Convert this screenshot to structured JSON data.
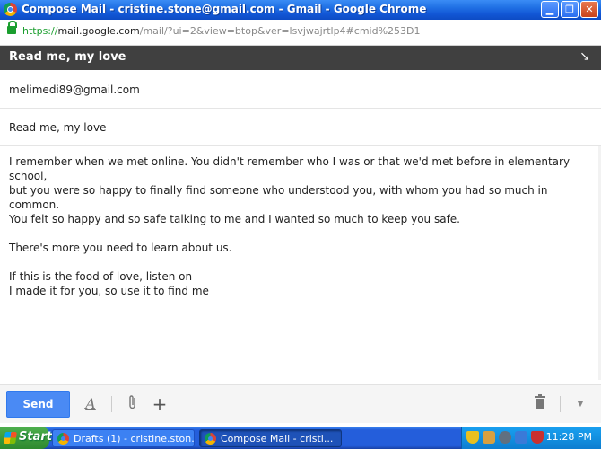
{
  "window": {
    "title": "Compose Mail - cristine.stone@gmail.com - Gmail - Google Chrome"
  },
  "address_bar": {
    "scheme": "https://",
    "host": "mail.google.com",
    "path": "/mail/?ui=2&view=btop&ver=lsvjwajrtlp4#cmid%253D1"
  },
  "compose": {
    "header_title": "Read me, my love",
    "to": "melimedi89@gmail.com",
    "subject": "Read me, my love",
    "body": [
      "I remember when we met online. You didn't remember who I was or that we'd met before in elementary school,\nbut you were so happy to finally find someone who understood you, with whom you had so much in common.\nYou felt so happy and so safe talking to me and I wanted so much to keep you safe.",
      "There's more you need to learn about us.",
      "If this is the food of love, listen on\nI made it for you, so use it to find me"
    ]
  },
  "toolbar": {
    "send_label": "Send"
  },
  "taskbar": {
    "start_label": "Start",
    "tasks": [
      {
        "label": "Drafts (1) - cristine.ston..."
      },
      {
        "label": "Compose Mail - cristi..."
      }
    ],
    "clock": "11:28 PM"
  }
}
